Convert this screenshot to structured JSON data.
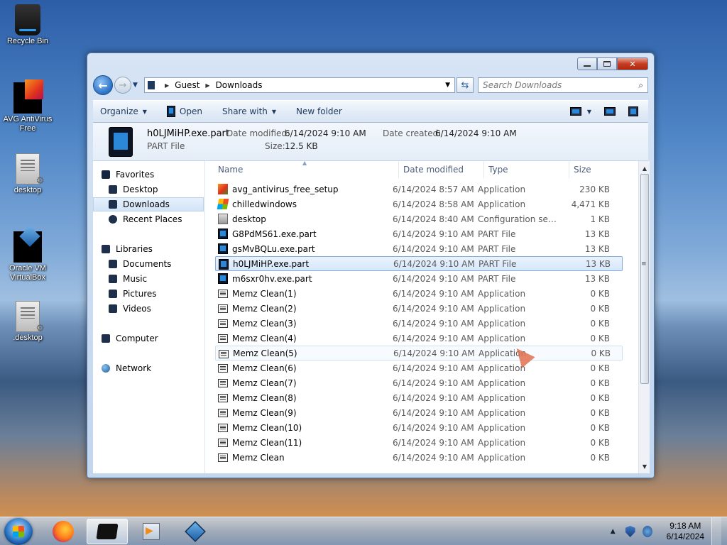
{
  "desktop": {
    "icons": [
      {
        "label": "Recycle Bin"
      },
      {
        "label": "AVG AntiVirus Free"
      },
      {
        "label": "desktop"
      },
      {
        "label": "Oracle VM VirtualBox"
      },
      {
        "label": ".desktop"
      }
    ]
  },
  "window": {
    "breadcrumb": [
      "Guest",
      "Downloads"
    ],
    "search_placeholder": "Search Downloads",
    "toolbar": {
      "organize": "Organize",
      "open": "Open",
      "share_with": "Share with",
      "new_folder": "New folder"
    },
    "details": {
      "name": "h0LJMiHP.exe.part",
      "type": "PART File",
      "date_modified_label": "Date modified:",
      "date_modified": "6/14/2024 9:10 AM",
      "date_created_label": "Date created:",
      "date_created": "6/14/2024 9:10 AM",
      "size_label": "Size:",
      "size": "12.5 KB"
    },
    "nav": {
      "favorites": "Favorites",
      "desktop": "Desktop",
      "downloads": "Downloads",
      "recent": "Recent Places",
      "libraries": "Libraries",
      "documents": "Documents",
      "music": "Music",
      "pictures": "Pictures",
      "videos": "Videos",
      "computer": "Computer",
      "network": "Network"
    },
    "columns": {
      "name": "Name",
      "date": "Date modified",
      "type": "Type",
      "size": "Size"
    },
    "files": [
      {
        "name": "avg_antivirus_free_setup",
        "date": "6/14/2024 8:57 AM",
        "type": "Application",
        "size": "230 KB",
        "icon": "avg-icon"
      },
      {
        "name": "chilledwindows",
        "date": "6/14/2024 8:58 AM",
        "type": "Application",
        "size": "4,471 KB",
        "icon": "windows-icon"
      },
      {
        "name": "desktop",
        "date": "6/14/2024 8:40 AM",
        "type": "Configuration sett...",
        "size": "1 KB",
        "icon": "config-icon"
      },
      {
        "name": "G8PdMS61.exe.part",
        "date": "6/14/2024 9:10 AM",
        "type": "PART File",
        "size": "13 KB",
        "icon": "part-icon"
      },
      {
        "name": "gsMvBQLu.exe.part",
        "date": "6/14/2024 9:10 AM",
        "type": "PART File",
        "size": "13 KB",
        "icon": "part-icon"
      },
      {
        "name": "h0LJMiHP.exe.part",
        "date": "6/14/2024 9:10 AM",
        "type": "PART File",
        "size": "13 KB",
        "icon": "part-icon"
      },
      {
        "name": "m6sxr0hv.exe.part",
        "date": "6/14/2024 9:10 AM",
        "type": "PART File",
        "size": "13 KB",
        "icon": "part-icon"
      },
      {
        "name": "Memz Clean(1)",
        "date": "6/14/2024 9:10 AM",
        "type": "Application",
        "size": "0 KB",
        "icon": "app-icon"
      },
      {
        "name": "Memz Clean(2)",
        "date": "6/14/2024 9:10 AM",
        "type": "Application",
        "size": "0 KB",
        "icon": "app-icon"
      },
      {
        "name": "Memz Clean(3)",
        "date": "6/14/2024 9:10 AM",
        "type": "Application",
        "size": "0 KB",
        "icon": "app-icon"
      },
      {
        "name": "Memz Clean(4)",
        "date": "6/14/2024 9:10 AM",
        "type": "Application",
        "size": "0 KB",
        "icon": "app-icon"
      },
      {
        "name": "Memz Clean(5)",
        "date": "6/14/2024 9:10 AM",
        "type": "Application",
        "size": "0 KB",
        "icon": "app-icon"
      },
      {
        "name": "Memz Clean(6)",
        "date": "6/14/2024 9:10 AM",
        "type": "Application",
        "size": "0 KB",
        "icon": "app-icon"
      },
      {
        "name": "Memz Clean(7)",
        "date": "6/14/2024 9:10 AM",
        "type": "Application",
        "size": "0 KB",
        "icon": "app-icon"
      },
      {
        "name": "Memz Clean(8)",
        "date": "6/14/2024 9:10 AM",
        "type": "Application",
        "size": "0 KB",
        "icon": "app-icon"
      },
      {
        "name": "Memz Clean(9)",
        "date": "6/14/2024 9:10 AM",
        "type": "Application",
        "size": "0 KB",
        "icon": "app-icon"
      },
      {
        "name": "Memz Clean(10)",
        "date": "6/14/2024 9:10 AM",
        "type": "Application",
        "size": "0 KB",
        "icon": "app-icon"
      },
      {
        "name": "Memz Clean(11)",
        "date": "6/14/2024 9:10 AM",
        "type": "Application",
        "size": "0 KB",
        "icon": "app-icon"
      },
      {
        "name": "Memz Clean",
        "date": "6/14/2024 9:10 AM",
        "type": "Application",
        "size": "0 KB",
        "icon": "app-icon"
      }
    ]
  },
  "taskbar": {
    "time": "9:18 AM",
    "date": "6/14/2024"
  }
}
